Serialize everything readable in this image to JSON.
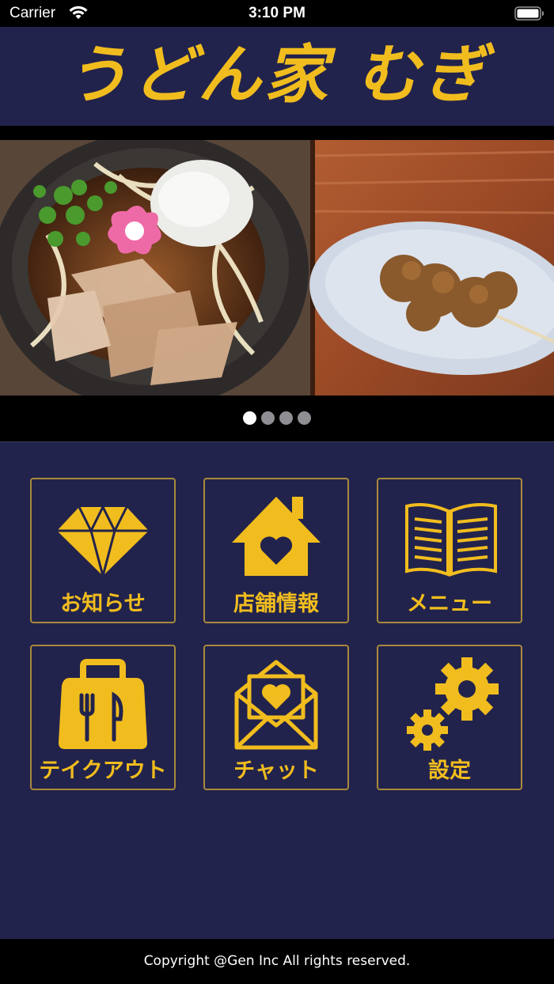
{
  "status_bar": {
    "carrier": "Carrier",
    "time": "3:10 PM"
  },
  "header": {
    "title": "うどん家 むぎ"
  },
  "carousel": {
    "page_count": 4,
    "current_page": 1
  },
  "menu": [
    {
      "label": "お知らせ",
      "icon": "diamond-icon"
    },
    {
      "label": "店舗情報",
      "icon": "house-heart-icon"
    },
    {
      "label": "メニュー",
      "icon": "open-book-icon"
    },
    {
      "label": "テイクアウト",
      "icon": "takeout-bag-icon"
    },
    {
      "label": "チャット",
      "icon": "envelope-heart-icon"
    },
    {
      "label": "設定",
      "icon": "gears-icon"
    }
  ],
  "footer": {
    "copyright": "Copyright @Gen Inc All rights reserved."
  },
  "colors": {
    "navy": "#22234c",
    "gold": "#f1bd1e",
    "border": "#a88a3c"
  }
}
